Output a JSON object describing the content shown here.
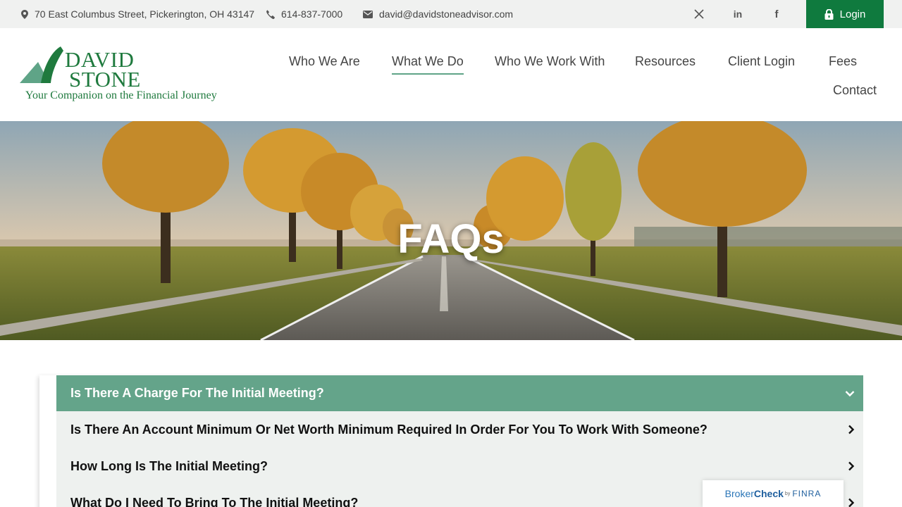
{
  "topbar": {
    "address": "70 East Columbus Street, Pickerington, OH 43147",
    "phone": "614-837-7000",
    "email": "david@davidstoneadvisor.com",
    "login_label": "Login"
  },
  "logo": {
    "line1": "DAVID",
    "line2": "STONE",
    "tagline": "Your Companion on the Financial Journey"
  },
  "nav": {
    "items": [
      "Who We Are",
      "What We Do",
      "Who We Work With",
      "Resources",
      "Client Login",
      "Fees",
      "Contact"
    ],
    "active": "What We Do"
  },
  "hero": {
    "title": "FAQs"
  },
  "faq": {
    "items": [
      "Is There A Charge For The Initial Meeting?",
      "Is There An Account Minimum Or Net Worth Minimum Required In Order For You To Work With Someone?",
      "How Long Is The Initial Meeting?",
      "What Do I Need To Bring To The Initial Meeting?"
    ]
  },
  "brokercheck": {
    "broker": "Broker",
    "check": "Check",
    "by": "by",
    "finra": "FINRA"
  },
  "colors": {
    "brand_green": "#0f7a3e",
    "faq_open": "#64a48a",
    "faq_closed": "#eef1ef"
  }
}
